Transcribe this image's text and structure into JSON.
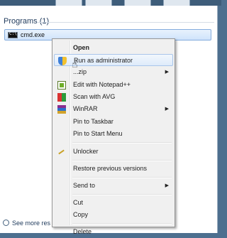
{
  "start_menu": {
    "section_title": "Programs (1)",
    "result": {
      "label": "cmd.exe",
      "icon": "cmd-icon"
    },
    "see_more": "See more res"
  },
  "context_menu": {
    "items": [
      {
        "label": "Open",
        "bold": true
      },
      {
        "label": "Run as administrator",
        "icon": "shield-icon",
        "highlighted": true
      },
      {
        "label": "...zip",
        "has_submenu": true
      },
      {
        "label": "Edit with Notepad++",
        "icon": "notepad-icon"
      },
      {
        "label": "Scan with AVG",
        "icon": "avg-icon"
      },
      {
        "label": "WinRAR",
        "icon": "winrar-icon",
        "has_submenu": true
      },
      {
        "label": "Pin to Taskbar"
      },
      {
        "label": "Pin to Start Menu"
      },
      {
        "label": "Unlocker",
        "icon": "unlocker-icon"
      },
      {
        "label": "Restore previous versions"
      },
      {
        "label": "Send to",
        "has_submenu": true
      },
      {
        "label": "Cut"
      },
      {
        "label": "Copy"
      },
      {
        "label": "Delete"
      }
    ],
    "submenu_arrow": "▶"
  }
}
